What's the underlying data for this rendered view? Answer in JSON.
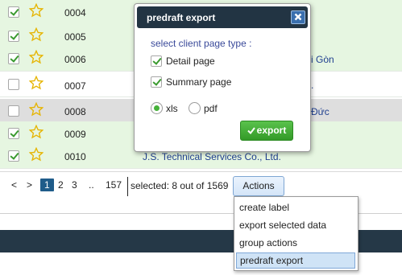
{
  "rows": [
    {
      "code": "0004",
      "name": "",
      "checked": true,
      "state": "sel"
    },
    {
      "code": "0005",
      "name": "",
      "checked": true,
      "state": "sel"
    },
    {
      "code": "0006",
      "name": "i Gòn",
      "checked": true,
      "state": "sel"
    },
    {
      "code": "0007",
      "name": ".",
      "checked": false,
      "state": "unsel"
    },
    {
      "code": "0008",
      "name": "Đức",
      "checked": false,
      "state": "hover"
    },
    {
      "code": "0009",
      "name": "",
      "checked": true,
      "state": "sel"
    },
    {
      "code": "0010",
      "name": "J.S. Technical Services Co., Ltd.",
      "checked": true,
      "state": "sel"
    }
  ],
  "pager": {
    "prev": "<",
    "next": ">",
    "pages": [
      "1",
      "2",
      "3"
    ],
    "ellipsis": "..",
    "last": "157",
    "selected_info": "selected: 8 out of 1569",
    "actions_label": "Actions"
  },
  "menu": {
    "items": [
      "create label",
      "export selected data",
      "group actions",
      "predraft export"
    ]
  },
  "dialog": {
    "title": "predraft export",
    "label": "select client page type :",
    "detail_label": "Detail page",
    "summary_label": "Summary page",
    "xls_label": "xls",
    "pdf_label": "pdf",
    "export_label": "export"
  },
  "colors": {
    "selected_row": "#e6f6e1",
    "dialog_header": "#223443",
    "footer": "#253847",
    "export_green": "#3aa52e",
    "current_page": "#1f5c8a"
  }
}
